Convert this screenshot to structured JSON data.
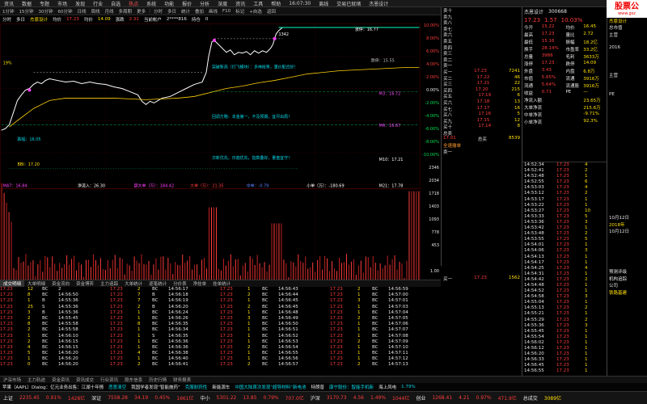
{
  "menu": {
    "items": [
      "资讯",
      "数据",
      "专题",
      "市场",
      "发现",
      "行业",
      "自选",
      "热点",
      "系统",
      "功能",
      "报价",
      "分析",
      "深度",
      "资讯",
      "工具",
      "帮助"
    ],
    "time": "16:07:30",
    "status": "离线",
    "links": [
      "交易已就绪",
      "杰恩设计"
    ]
  },
  "toolbar": {
    "items": [
      "1分钟",
      "15分钟",
      "30分钟",
      "60分钟",
      "日线",
      "周线",
      "月线",
      "多周期",
      "更多",
      "|",
      "分时",
      "多日",
      "统计",
      "叠加",
      "画线",
      "F10",
      "标记",
      "+自选",
      "返回"
    ]
  },
  "chartbar": {
    "label": "分时",
    "mode": "多日",
    "name": "杰恩设计",
    "price_label": "均价",
    "price": "17.23",
    "avg_label": "均价",
    "avg": "14.09",
    "vol_label": "涨跌",
    "vol": "2.31",
    "acc_label": "当前帐户",
    "acc": "2****816",
    "pos_label": "持仓",
    "pos": "0"
  },
  "chart": {
    "labels": {
      "high": "1342",
      "zhangting": "涨停：16.77",
      "top_text": "突破新高（打飞模块）：多神抢筹，量价配合好！",
      "ma": "M3：16.72",
      "ma2": "M6：16.67",
      "dieting": "跌停：15.55",
      "mid_text1": "回调方略：本金第一，不及预期，宜尽出局！",
      "mid_text2": "次新优先，日趋优先，指数叠好，量盘宜守！",
      "low_label": "跌幅：16.05",
      "bbi": "BBI：17.20",
      "m10": "M10：17.21",
      "percent": "19%",
      "ma_line1": "MA7：16.84",
      "ma_line2": "净流入：26.30",
      "ma_line3": "超大单（万）：184.42",
      "ma_line4": "大单（万）：21.35",
      "ma_line5": "中单：-0.79",
      "ma_line6": "小单（万）：-180.69",
      "ma_line7": "M21：17.78"
    },
    "right_axis": [
      "10.00%",
      "8.00%",
      "6.00%",
      "4.00%",
      "2.00%",
      "0.00%",
      "-2.00%",
      "-4.00%",
      "-6.00%",
      "-8.00%",
      "-10.00%",
      "2346",
      "2034",
      "1718",
      "1403",
      "1093",
      "778",
      "453",
      "",
      "1.00"
    ]
  },
  "tabs2": [
    "成交明细",
    "大单明细",
    "资金流向",
    "资金博弈",
    "主力追踪",
    "大单统计",
    "逐笔统计",
    "分价表",
    "净挂单",
    "挂单统计"
  ],
  "trades": [
    [
      [
        "17.23",
        "12",
        "BC",
        "2"
      ],
      [
        "17.23",
        "8",
        "BC",
        "14:56:50"
      ],
      [
        "17.23",
        "1",
        "B",
        "14:55:36"
      ],
      [
        "17.23",
        "25",
        "S",
        "14:55:36"
      ],
      [
        "17.23",
        "3",
        "B",
        "14:55:36"
      ],
      [
        "17.23",
        "2",
        "BC",
        "14:55:45"
      ],
      [
        "17.23",
        "8",
        "BC",
        "14:55:58"
      ],
      [
        "17.23",
        "2",
        "BC",
        "14:55:58"
      ],
      [
        "17.23",
        "1",
        "BC",
        "14:56:10"
      ],
      [
        "17.23",
        "2",
        "BC",
        "14:56:15"
      ],
      [
        "17.23",
        "4",
        "BC",
        "14:56:15"
      ],
      [
        "17.23",
        "5",
        "BC",
        "14:56:20"
      ],
      [
        "17.23",
        "1",
        "BC",
        "14:56:20"
      ],
      [
        "17.23",
        "0",
        "BC",
        "14:56:20"
      ]
    ],
    [
      [
        "17.23",
        "2",
        "BC",
        "14:56:17"
      ],
      [
        "17.23",
        "7",
        "B",
        "14:56:18"
      ],
      [
        "17.23",
        "7",
        "BC",
        "14:56:19"
      ],
      [
        "17.23",
        "2",
        "B",
        "14:56:20"
      ],
      [
        "17.23",
        "1",
        "BC",
        "14:56:24"
      ],
      [
        "17.23",
        "1",
        "BC",
        "14:56:26"
      ],
      [
        "17.23",
        "8",
        "BC",
        "14:56:35"
      ],
      [
        "17.23",
        "1",
        "BC",
        "14:56:34"
      ],
      [
        "17.23",
        "1",
        "S",
        "14:56:35"
      ],
      [
        "17.23",
        "1",
        "BC",
        "14:56:36"
      ],
      [
        "17.23",
        "1",
        "BC",
        "14:56:36"
      ],
      [
        "17.23",
        "4",
        "BC",
        "14:56:38"
      ],
      [
        "17.23",
        "1",
        "BC",
        "14:56:40"
      ],
      [
        "17.23",
        "2",
        "BC",
        "14:56:41"
      ]
    ],
    [
      [
        "17.23",
        "1",
        "BC",
        "14:56:43"
      ],
      [
        "17.23",
        "2",
        "BC",
        "14:56:44"
      ],
      [
        "17.23",
        "1",
        "BC",
        "14:56:45"
      ],
      [
        "17.23",
        "2",
        "BC",
        "14:56:45"
      ],
      [
        "17.23",
        "1",
        "BC",
        "14:56:48"
      ],
      [
        "17.23",
        "3",
        "BC",
        "14:56:49"
      ],
      [
        "17.23",
        "1",
        "BC",
        "14:56:50"
      ],
      [
        "17.23",
        "1",
        "BC",
        "14:56:51"
      ],
      [
        "17.23",
        "1",
        "BC",
        "14:56:52"
      ],
      [
        "17.23",
        "1",
        "BC",
        "14:56:53"
      ],
      [
        "17.23",
        "2",
        "BC",
        "14:56:54"
      ],
      [
        "17.23",
        "1",
        "BC",
        "14:56:55"
      ],
      [
        "17.23",
        "1",
        "BC",
        "14:56:56"
      ],
      [
        "17.23",
        "2",
        "BC",
        "14:56:57"
      ]
    ],
    [
      [
        "17.23",
        "2",
        "BC",
        "14:56:59"
      ],
      [
        "17.23",
        "1",
        "BC",
        "14:57:00"
      ],
      [
        "17.23",
        "3",
        "BC",
        "14:57:01"
      ],
      [
        "17.23",
        "1",
        "BC",
        "14:57:03"
      ],
      [
        "17.23",
        "1",
        "BC",
        "14:57:04"
      ],
      [
        "17.23",
        "2",
        "BC",
        "14:57:05"
      ],
      [
        "17.23",
        "1",
        "BC",
        "14:57:06"
      ],
      [
        "17.23",
        "1",
        "BC",
        "14:57:07"
      ],
      [
        "17.23",
        "1",
        "BC",
        "14:57:08"
      ],
      [
        "17.23",
        "2",
        "BC",
        "14:57:09"
      ],
      [
        "17.23",
        "1",
        "BC",
        "14:57:10"
      ],
      [
        "17.23",
        "1",
        "BC",
        "14:57:11"
      ],
      [
        "17.23",
        "1",
        "BC",
        "14:57:12"
      ],
      [
        "17.23",
        "2",
        "BC",
        "14:57:13"
      ]
    ]
  ],
  "orderbook": {
    "sells": [
      "卖十",
      "卖九",
      "卖八",
      "卖七",
      "卖六",
      "卖五",
      "卖四",
      "卖三",
      "卖二",
      "卖一"
    ],
    "buys": [
      [
        "买一",
        "17.23",
        "7241"
      ],
      [
        "买二",
        "17.22",
        "46"
      ],
      [
        "买三",
        "17.21",
        "22"
      ],
      [
        "买四",
        "17.20",
        "215"
      ],
      [
        "买五",
        "17.19",
        "6"
      ],
      [
        "买六",
        "17.18",
        "13"
      ],
      [
        "买七",
        "17.17",
        "16"
      ],
      [
        "买八",
        "17.16",
        "5"
      ],
      [
        "买九",
        "17.15",
        "12"
      ],
      [
        "买十",
        "17.14",
        "8"
      ]
    ],
    "total_buy_label": "总买",
    "total_buy": "8539",
    "total_sell_label": "总卖",
    "avg_buy": "17.01",
    "avg_sell": "",
    "cancel_text": "全速撤单",
    "mid_label": "卖一",
    "buy2_label": "买一",
    "buy2_price": "17.23",
    "buy2_vol": "1562"
  },
  "quote": {
    "title": "杰恩设计",
    "code": "300668",
    "price": "17.23",
    "change": "1.57",
    "pct": "10.03%",
    "rows": [
      [
        "今开",
        "15.22",
        "均价",
        "16.45"
      ],
      [
        "最高",
        "17.23",
        "量比",
        "2.72"
      ],
      [
        "最低",
        "15.16",
        "振幅",
        "18.2亿"
      ],
      [
        "换手",
        "28.14%",
        "市盈率",
        "33.2亿"
      ],
      [
        "总量",
        "3986",
        "毛利",
        "3633万"
      ],
      [
        "涨停",
        "17.23",
        "跌停",
        "14.09"
      ],
      [
        "外盘",
        "3.43",
        "内盘",
        "6.8万"
      ],
      [
        "市值",
        "5.65%",
        "流通",
        "3916万"
      ],
      [
        "流通",
        "5.64%",
        "流通股",
        "3916万"
      ],
      [
        "收益",
        "0.71",
        "PE",
        "—"
      ],
      [
        "净流入额",
        "",
        "",
        "23.65万"
      ],
      [
        "大单净流",
        "",
        "",
        "215.6万"
      ],
      [
        "中单净流",
        "",
        "",
        "-9.71%"
      ],
      [
        "小单净流",
        "",
        "",
        "92.3%"
      ]
    ]
  },
  "ticks": [
    [
      "14:52:34",
      "17.23",
      "4"
    ],
    [
      "14:52:41",
      "17.23",
      "2"
    ],
    [
      "14:52:48",
      "17.23",
      "1"
    ],
    [
      "14:52:55",
      "17.23",
      "6"
    ],
    [
      "14:53:03",
      "17.23",
      "4"
    ],
    [
      "14:53:12",
      "17.23",
      "2"
    ],
    [
      "14:53:17",
      "17.23",
      "1"
    ],
    [
      "14:53:22",
      "17.23",
      "1"
    ],
    [
      "14:53:27",
      "17.23",
      "10"
    ],
    [
      "14:53:33",
      "17.23",
      "5"
    ],
    [
      "14:53:36",
      "17.23",
      "3"
    ],
    [
      "14:53:42",
      "17.23",
      "1"
    ],
    [
      "14:53:48",
      "17.23",
      "2"
    ],
    [
      "14:53:55",
      "17.23",
      "5"
    ],
    [
      "14:54:01",
      "17.23",
      "1"
    ],
    [
      "14:54:06",
      "17.23",
      "3"
    ],
    [
      "14:54:13",
      "17.23",
      "1"
    ],
    [
      "14:54:17",
      "17.23",
      "1"
    ],
    [
      "14:54:25",
      "17.23",
      "4"
    ],
    [
      "14:54:31",
      "17.23",
      "1"
    ],
    [
      "14:54:42",
      "17.23",
      "2"
    ],
    [
      "14:54:48",
      "17.23",
      "1"
    ],
    [
      "14:54:52",
      "17.23",
      "1"
    ],
    [
      "14:54:58",
      "17.23",
      "3"
    ],
    [
      "14:55:04",
      "17.23",
      "1"
    ],
    [
      "14:55:13",
      "17.23",
      "2"
    ],
    [
      "14:55:21",
      "17.23",
      "1"
    ],
    [
      "14:55:29",
      "17.23",
      "2"
    ],
    [
      "14:55:36",
      "17.23",
      "3"
    ],
    [
      "14:55:45",
      "17.23",
      "1"
    ],
    [
      "14:55:54",
      "17.23",
      "1"
    ],
    [
      "14:56:02",
      "17.23",
      "1"
    ],
    [
      "14:56:12",
      "17.23",
      "1"
    ],
    [
      "14:56:20",
      "17.23",
      "1"
    ],
    [
      "14:56:33",
      "17.23",
      "1"
    ],
    [
      "14:56:45",
      "17.23",
      "1"
    ],
    [
      "14:56:55",
      "17.23",
      "1"
    ]
  ],
  "rightpanel": [
    "杰恩设计",
    "总市值",
    "主营",
    "",
    "2016",
    "",
    "",
    "",
    "主营",
    "",
    "",
    "PE",
    "",
    "",
    "",
    "",
    "",
    "",
    "",
    "",
    "",
    "",
    "",
    "",
    "",
    "",
    "",
    "",
    "",
    "10月12日",
    "2018年",
    "10月12日",
    "",
    "",
    "",
    "",
    "",
    "预测评级",
    "机构追踪",
    "公司",
    "铁路基建",
    "",
    "",
    "",
    "",
    "",
    "",
    "",
    "",
    "",
    "",
    ""
  ],
  "logo": {
    "l1": "股票公",
    "l2": "www.gsz"
  },
  "bottomtabs": [
    "沪深市场",
    "主力轨迹",
    "资金资讯",
    "资讯成交",
    "行业资讯",
    "股东信息",
    "历史行情",
    "财务报表"
  ],
  "ticker": [
    "苹果（AAPL）Dialog：亿元业务出售：江湖十年情",
    "恶意清空",
    "我国学者发现“智能施药”",
    "克服耐药性",
    "新能源车",
    "中国大陆首次发现“超导材料”新电池",
    "特朗普",
    "康宁股份：智能手机新",
    "海上风电",
    "1.79%"
  ],
  "status": [
    [
      "上证",
      "2235.45",
      "0.91%",
      "1428亿"
    ],
    [
      "深证",
      "7558.28",
      "34.19",
      "0.45%",
      "1661亿"
    ],
    [
      "中小",
      "5301.22",
      "13.85",
      "0.79%",
      "707.0亿"
    ],
    [
      "沪深",
      "3170.73",
      "4.56",
      "1.49%",
      "1044亿"
    ],
    [
      "创业",
      "1268.41",
      "4.21",
      "0.97%",
      "471.9亿"
    ],
    [
      "总成交",
      "3089亿"
    ]
  ],
  "colors": {
    "up": "#ff3c3c",
    "down": "#00e050",
    "price": "#ffffff",
    "avg": "#ffe000",
    "bg": "#000000"
  }
}
